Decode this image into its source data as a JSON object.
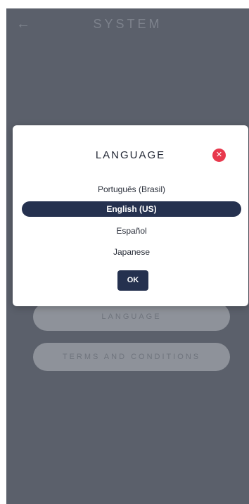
{
  "header": {
    "back_icon": "arrow-left-icon",
    "title": "SYSTEM"
  },
  "background_menu": {
    "language_label": "LANGUAGE",
    "terms_label": "TERMS AND CONDITIONS"
  },
  "modal": {
    "title": "LANGUAGE",
    "close_icon": "close-icon",
    "options": [
      {
        "label": "Português (Brasil)",
        "selected": false
      },
      {
        "label": "English (US)",
        "selected": true
      },
      {
        "label": "Español",
        "selected": false
      },
      {
        "label": "Japanese",
        "selected": false
      }
    ],
    "ok_label": "OK"
  },
  "colors": {
    "accent": "#25314f",
    "close": "#e8394d",
    "overlay_bg": "#5b606b"
  }
}
